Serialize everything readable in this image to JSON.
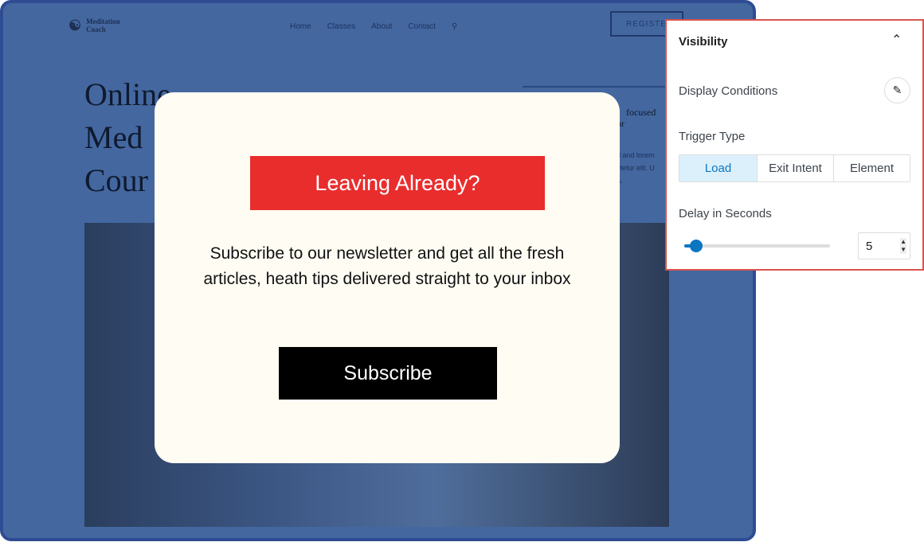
{
  "site": {
    "logo_line1": "Meditation",
    "logo_line2": "Coach",
    "nav": [
      "Home",
      "Classes",
      "About",
      "Contact"
    ],
    "register": "REGISTER",
    "hero": [
      "Online",
      "Med",
      "Cour"
    ],
    "right_heading": [
      "focused",
      "or"
    ],
    "right_text": [
      "d and lorem",
      "ctetur elit. U",
      "a."
    ]
  },
  "popup": {
    "heading": "Leaving Already?",
    "message": "Subscribe to our newsletter and get all the fresh articles, heath tips delivered straight to your inbox",
    "button": "Subscribe",
    "heading_bg": "#e92d2d"
  },
  "panel": {
    "title": "Visibility",
    "display_conditions": "Display Conditions",
    "trigger_type": "Trigger Type",
    "triggers": [
      "Load",
      "Exit Intent",
      "Element"
    ],
    "selected_trigger": "Load",
    "delay_label": "Delay in Seconds",
    "delay_value": "5",
    "slider_percent": 8,
    "accent": "#0a76c2"
  }
}
